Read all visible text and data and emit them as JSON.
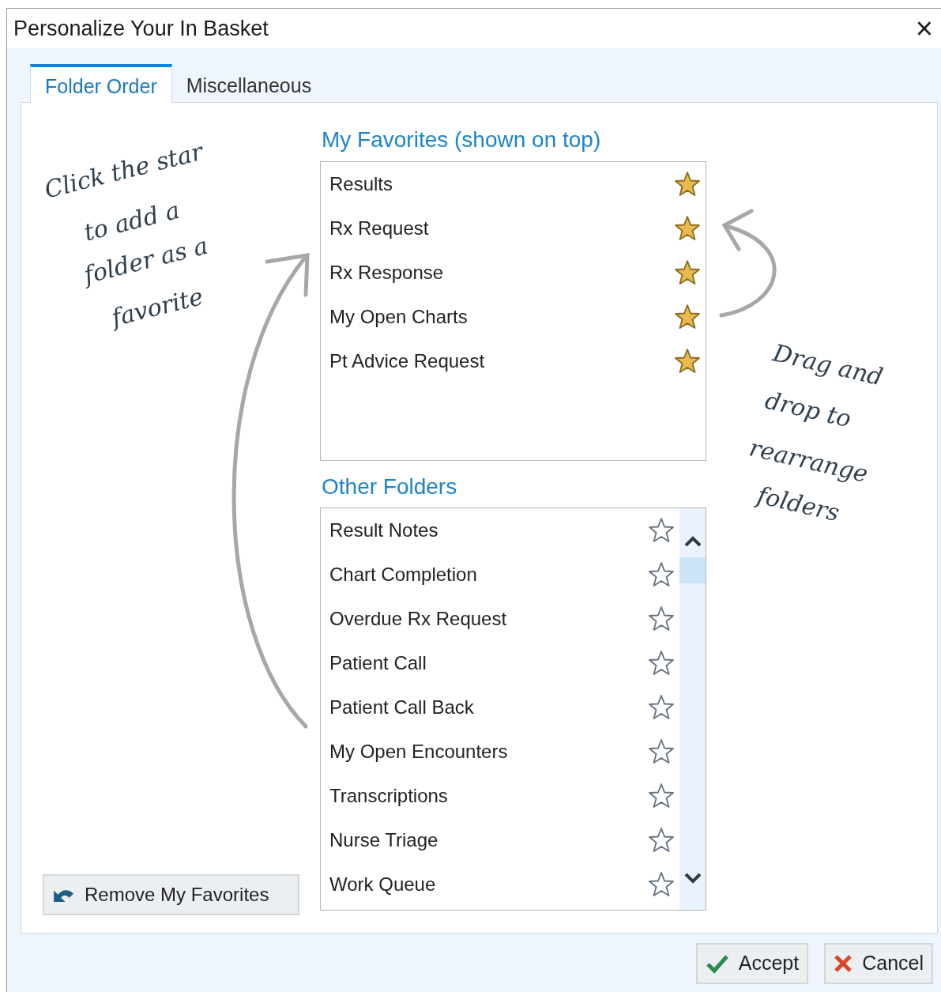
{
  "window": {
    "title": "Personalize Your In Basket",
    "close": "×"
  },
  "tabs": [
    {
      "label": "Folder Order",
      "selected": true
    },
    {
      "label": "Miscellaneous",
      "selected": false
    }
  ],
  "favorites": {
    "heading": "My Favorites (shown on top)",
    "items": [
      {
        "name": "Results",
        "starred": true
      },
      {
        "name": "Rx Request",
        "starred": true
      },
      {
        "name": "Rx Response",
        "starred": true
      },
      {
        "name": "My Open Charts",
        "starred": true
      },
      {
        "name": "Pt Advice Request",
        "starred": true
      }
    ]
  },
  "other_folders": {
    "heading": "Other Folders",
    "items": [
      {
        "name": "Result Notes",
        "starred": false
      },
      {
        "name": "Chart Completion",
        "starred": false
      },
      {
        "name": "Overdue Rx Request",
        "starred": false
      },
      {
        "name": "Patient Call",
        "starred": false
      },
      {
        "name": "Patient Call Back",
        "starred": false
      },
      {
        "name": "My Open Encounters",
        "starred": false
      },
      {
        "name": "Transcriptions",
        "starred": false
      },
      {
        "name": "Nurse Triage",
        "starred": false
      },
      {
        "name": "Work Queue",
        "starred": false
      }
    ]
  },
  "annotations": [
    {
      "lines": [
        "Click the star",
        "to add a",
        "folder as a",
        "favorite"
      ]
    },
    {
      "lines": [
        "Drag and",
        "drop to",
        "rearrange",
        "folders"
      ]
    }
  ],
  "remove_button": "Remove My Favorites",
  "buttons": [
    {
      "kind": "accept",
      "label": "Accept"
    },
    {
      "kind": "cancel",
      "label": "Cancel"
    }
  ]
}
